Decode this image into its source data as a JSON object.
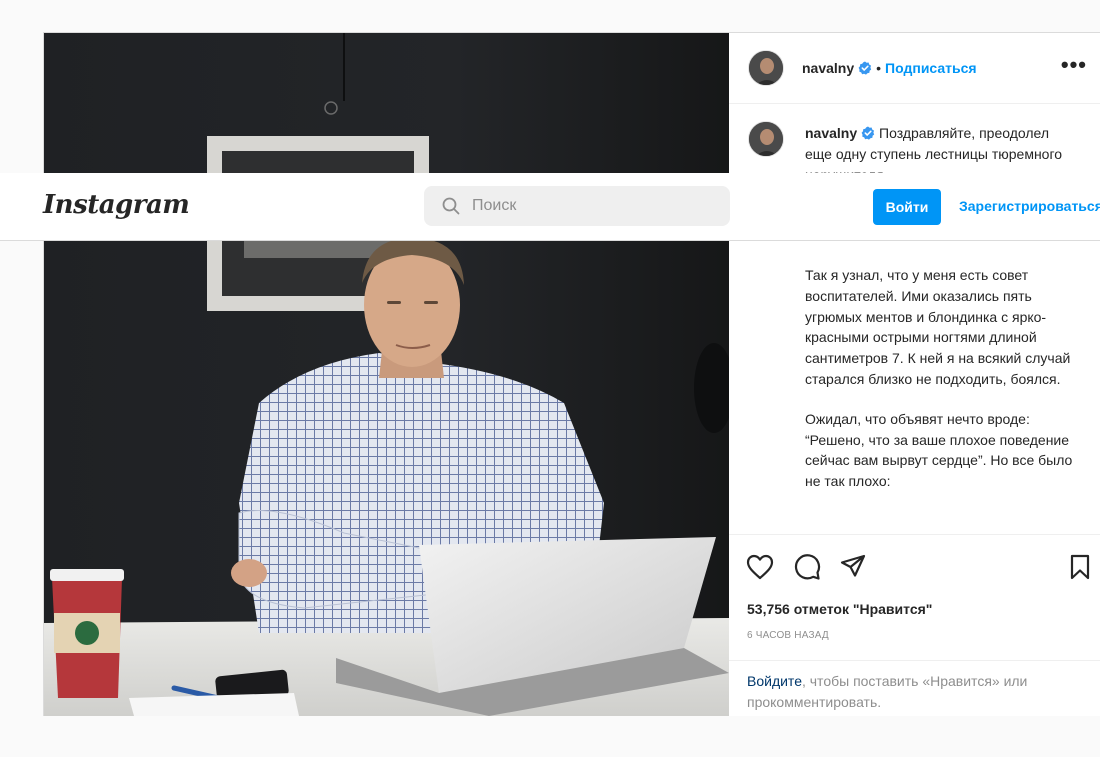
{
  "topbar": {
    "logo": "Instagram",
    "search_placeholder": "Поиск",
    "login_button": "Войти",
    "signup_button": "Зарегистрироваться"
  },
  "post": {
    "username": "navalny",
    "follow_label": "Подписаться",
    "dot": "•",
    "more": "•••",
    "caption_intro": "Поздравляйте, преодолел еще одну ступень лестницы тюремного нарушителя.",
    "caption_paragraphs": [
      "Так я узнал, что у меня есть совет воспитателей. Ими оказались пять угрюмых ментов и блондинка с ярко-красными острыми ногтями длиной сантиметров 7. К ней я на всякий случай старался близко не подходить, боялся.",
      "Ожидал, что объявят нечто вроде: “Решено, что за ваше плохое поведение сейчас вам вырвут сердце”. Но все было не так плохо:"
    ],
    "likes": "53,756 отметок \"Нравится\"",
    "time_ago": "6 ЧАСОВ НАЗАД",
    "login_prompt_link": "Войдите",
    "login_prompt_rest": ", чтобы поставить «Нравится» или прокомментировать."
  },
  "colors": {
    "accent": "#0095f6",
    "text": "#262626",
    "muted": "#8e8e8e",
    "border": "#dbdbdb"
  },
  "icons": [
    "search-icon",
    "verified-badge-icon",
    "heart-icon",
    "comment-icon",
    "share-icon",
    "bookmark-icon",
    "more-options-icon"
  ]
}
